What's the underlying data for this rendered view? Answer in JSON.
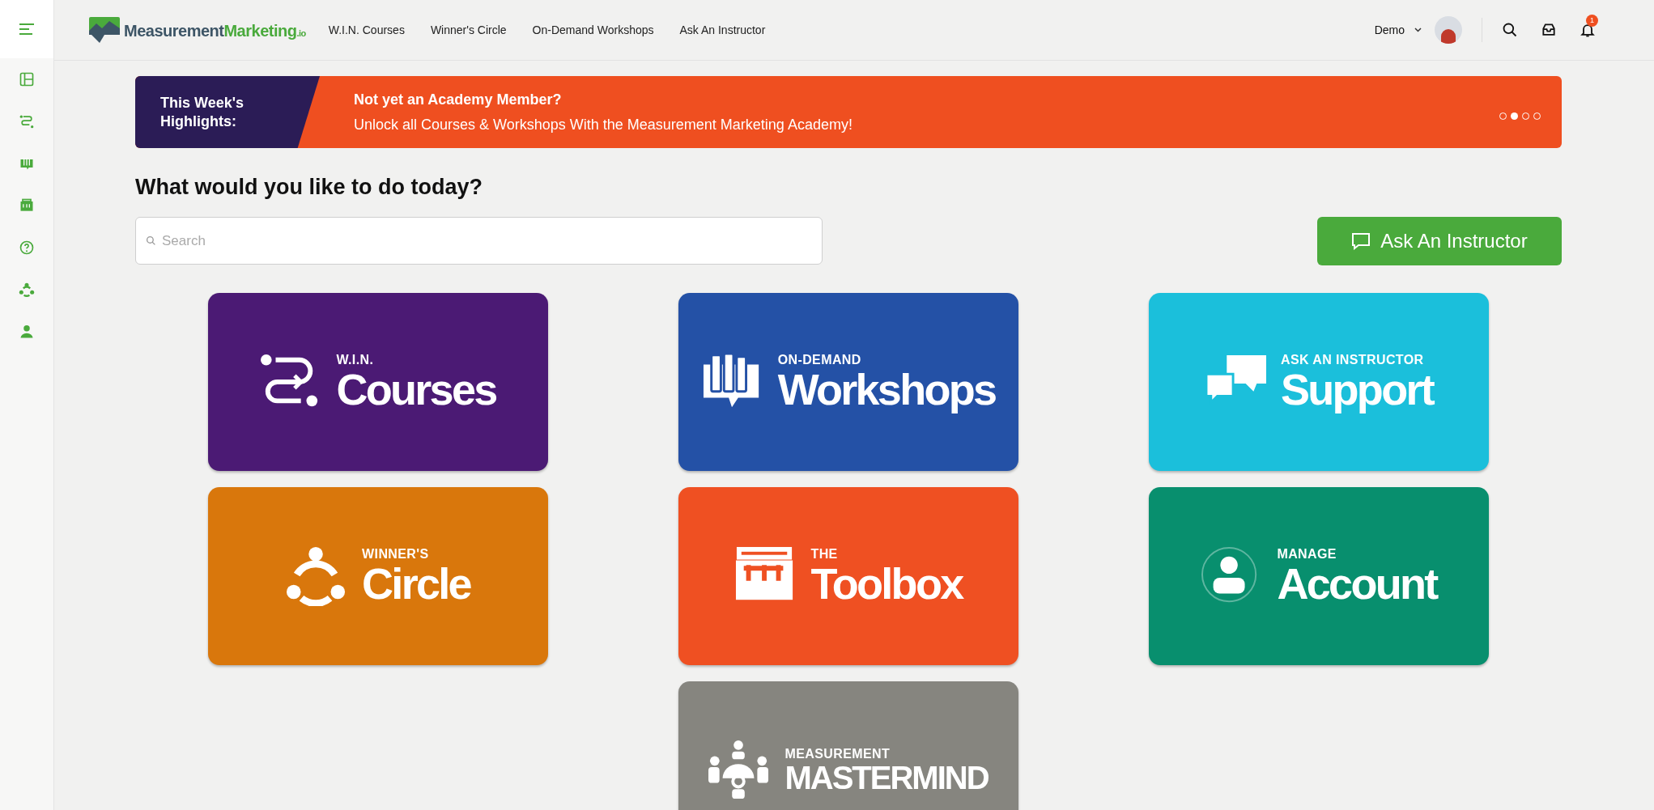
{
  "sidebar": {
    "items": [
      {
        "kind": "layout"
      },
      {
        "kind": "path"
      },
      {
        "kind": "workshops"
      },
      {
        "kind": "toolbox"
      },
      {
        "kind": "help"
      },
      {
        "kind": "circle"
      },
      {
        "kind": "account"
      }
    ]
  },
  "header": {
    "logo": {
      "first": "Measurement",
      "second": "Marketing",
      "suffix": ".io"
    },
    "nav": [
      "W.I.N. Courses",
      "Winner's Circle",
      "On-Demand Workshops",
      "Ask An Instructor"
    ],
    "user": "Demo",
    "notification_count": "1"
  },
  "banner": {
    "label": "This Week's Highlights:",
    "title": "Not yet an Academy Member?",
    "text": "Unlock all Courses & Workshops With the Measurement Marketing Academy!",
    "dots": [
      {
        "selected": false
      },
      {
        "selected": true
      },
      {
        "selected": false
      },
      {
        "selected": false
      }
    ]
  },
  "heading": "What would you like to do today?",
  "search": {
    "placeholder": "Search"
  },
  "ask_button": "Ask An Instructor",
  "tiles": [
    {
      "kind": "path",
      "small": "W.I.N.",
      "big": "Courses",
      "color": "#4b1a74"
    },
    {
      "kind": "books",
      "small": "ON-DEMAND",
      "big": "Workshops",
      "color": "#2451a6"
    },
    {
      "kind": "chat",
      "small": "ASK AN INSTRUCTOR",
      "big": "Support",
      "color": "#1bbfdb"
    },
    {
      "kind": "circle",
      "small": "WINNER'S",
      "big": "Circle",
      "color": "#d9770c"
    },
    {
      "kind": "toolbox",
      "small": "THE",
      "big": "Toolbox",
      "color": "#ef5022"
    },
    {
      "kind": "account",
      "small": "MANAGE",
      "big": "Account",
      "color": "#088f6e"
    },
    {
      "kind": "mastermind",
      "small": "MEASUREMENT",
      "big": "MASTERMIND",
      "color": "#86857f"
    }
  ]
}
